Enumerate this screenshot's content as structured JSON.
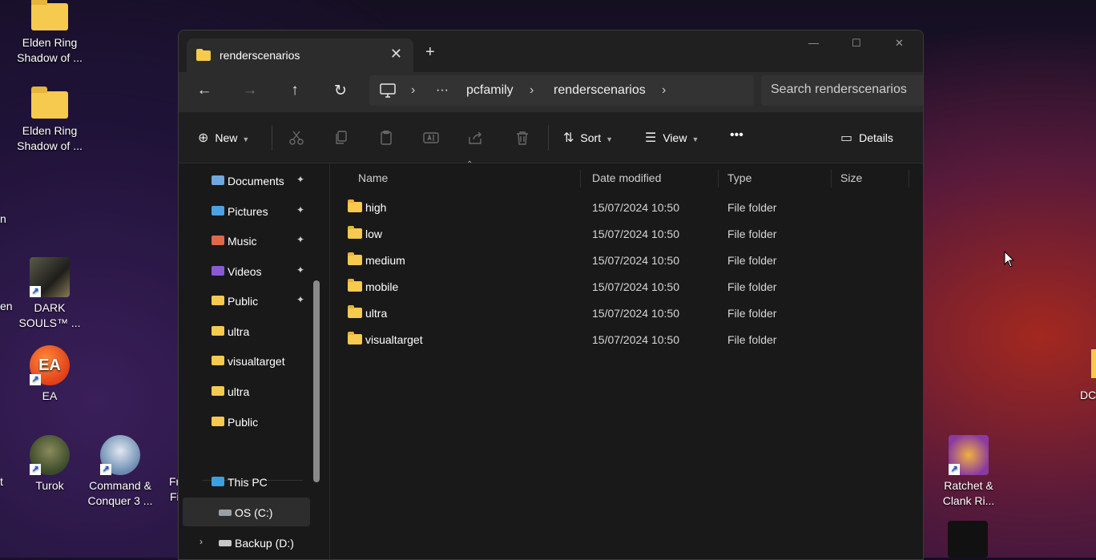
{
  "desktop": {
    "icons": [
      {
        "label": "Elden Ring Shadow of ...",
        "line1": "Elden Ring",
        "line2": "Shadow of ..."
      },
      {
        "label": "Elden Ring Shadow of ...",
        "line1": "Elden Ring",
        "line2": "Shadow of ..."
      },
      {
        "line1": "DARK",
        "line2": "SOULS™ ..."
      },
      {
        "line1": "EA",
        "line2": ""
      },
      {
        "line1": "Turok",
        "line2": ""
      },
      {
        "line1": "Command &",
        "line2": "Conquer 3 ..."
      },
      {
        "line1": "Ratchet &",
        "line2": "Clank Ri..."
      }
    ],
    "edge_left_1": "n",
    "edge_left_2": "en",
    "edge_left_3": "t",
    "edge_mid_1": "Fr",
    "edge_mid_2": "Fi",
    "edge_right_1": "DC"
  },
  "window": {
    "tab_title": "renderscenarios",
    "new_tab_symbol": "+",
    "close_symbol": "✕",
    "controls": {
      "minimize": "—",
      "maximize": "☐",
      "close": "✕"
    }
  },
  "address": {
    "dots": "···",
    "segments": [
      "pcfamily",
      "renderscenarios"
    ],
    "chevron": "›"
  },
  "search": {
    "placeholder": "Search renderscenarios"
  },
  "toolbar": {
    "new_label": "New",
    "sort_label": "Sort",
    "view_label": "View",
    "more_label": "•••",
    "details_label": "Details"
  },
  "sidebar": {
    "quick_access": [
      {
        "label": "Documents",
        "pinned": true,
        "color": "#6fa8dc"
      },
      {
        "label": "Pictures",
        "pinned": true,
        "color": "#4aa3e0"
      },
      {
        "label": "Music",
        "pinned": true,
        "color": "#e0674a"
      },
      {
        "label": "Videos",
        "pinned": true,
        "color": "#8a5ad6"
      },
      {
        "label": "Public",
        "pinned": true,
        "color": "#f6c94f"
      },
      {
        "label": "ultra",
        "pinned": false,
        "color": "#f6c94f"
      },
      {
        "label": "visualtarget",
        "pinned": false,
        "color": "#f6c94f"
      },
      {
        "label": "ultra",
        "pinned": false,
        "color": "#f6c94f"
      },
      {
        "label": "Public",
        "pinned": false,
        "color": "#f6c94f"
      }
    ],
    "this_pc": "This PC",
    "drives": [
      "OS (C:)",
      "Backup (D:)"
    ],
    "pin_symbol": "📌"
  },
  "columns": {
    "name": "Name",
    "date": "Date modified",
    "type": "Type",
    "size": "Size"
  },
  "files": [
    {
      "name": "high",
      "date": "15/07/2024 10:50",
      "type": "File folder"
    },
    {
      "name": "low",
      "date": "15/07/2024 10:50",
      "type": "File folder"
    },
    {
      "name": "medium",
      "date": "15/07/2024 10:50",
      "type": "File folder"
    },
    {
      "name": "mobile",
      "date": "15/07/2024 10:50",
      "type": "File folder"
    },
    {
      "name": "ultra",
      "date": "15/07/2024 10:50",
      "type": "File folder"
    },
    {
      "name": "visualtarget",
      "date": "15/07/2024 10:50",
      "type": "File folder"
    }
  ],
  "colors": {
    "accent_folder": "#f6c94f",
    "window_bg": "#191919",
    "titlebar_bg": "#202020"
  }
}
